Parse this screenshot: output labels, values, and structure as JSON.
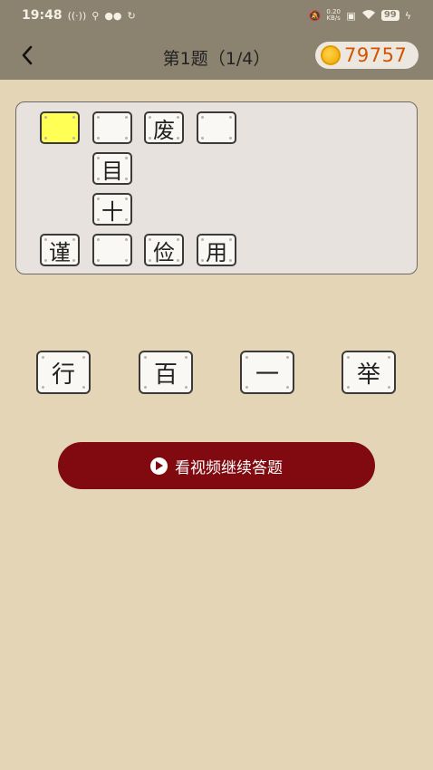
{
  "status_bar": {
    "time": "19:48",
    "left_icons": [
      "nfc-icon",
      "usb-icon",
      "wechat-icon",
      "sync-icon"
    ],
    "network_speed": "0.20 KB/s",
    "battery_level": "99"
  },
  "header": {
    "title": "第1题（1/4）",
    "coins": "79757"
  },
  "puzzle": {
    "cells": [
      {
        "char": "",
        "active": true
      },
      {
        "char": ""
      },
      {
        "char": "废"
      },
      {
        "char": ""
      },
      {
        "char": "目"
      },
      {
        "char": "十"
      },
      {
        "char": "谨"
      },
      {
        "char": ""
      },
      {
        "char": "俭"
      },
      {
        "char": "用"
      }
    ]
  },
  "options": [
    "行",
    "百",
    "一",
    "举"
  ],
  "video_button": {
    "label": "看视频继续答题"
  },
  "colors": {
    "header_bg": "#8b8370",
    "page_bg": "#e4d5b7",
    "active_cell": "#ffff55",
    "video_button": "#800a10",
    "coin_text": "#d35400"
  }
}
